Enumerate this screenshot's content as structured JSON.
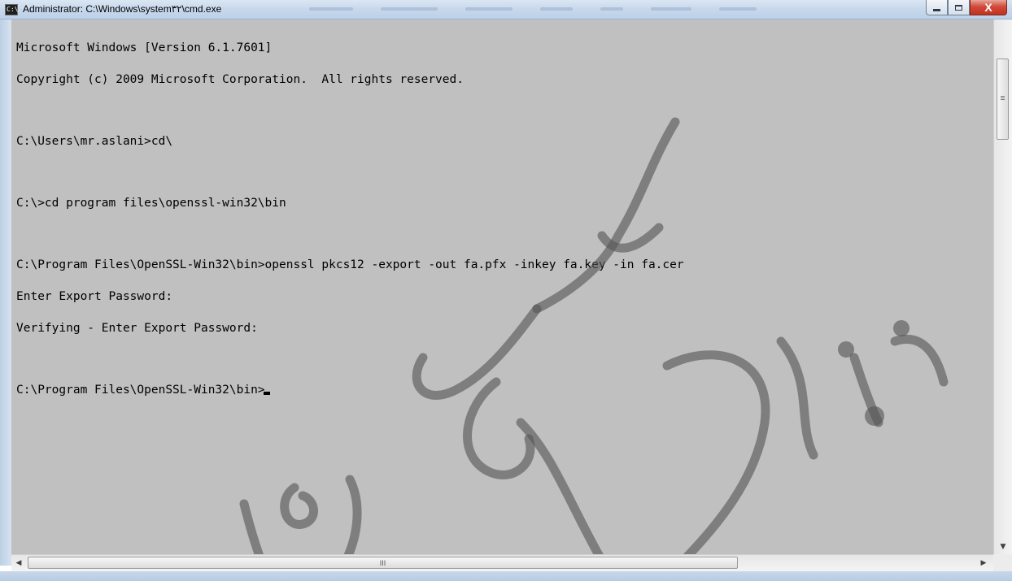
{
  "window": {
    "title": "Administrator: C:\\Windows\\system۳۲\\cmd.exe",
    "icon": "cmd-icon",
    "icon_text": "C:\\",
    "buttons": {
      "minimize": "minimize-icon",
      "maximize": "maximize-icon",
      "close_label": "X"
    }
  },
  "console": {
    "background": "#c0c0c0",
    "foreground": "#000000",
    "lines": [
      "Microsoft Windows [Version 6.1.7601]",
      "Copyright (c) 2009 Microsoft Corporation.  All rights reserved.",
      "",
      "C:\\Users\\mr.aslani>cd\\",
      "",
      "C:\\>cd program files\\openssl-win32\\bin",
      "",
      "C:\\Program Files\\OpenSSL-Win32\\bin>openssl pkcs12 -export -out fa.pfx -inkey fa.key -in fa.cer",
      "Enter Export Password:",
      "Verifying - Enter Export Password:",
      "",
      "C:\\Program Files\\OpenSSL-Win32\\bin>"
    ]
  },
  "watermark": {
    "text": "mr.aslani.ir"
  },
  "scrollbars": {
    "vertical": {
      "up_icon": "scroll-up-icon",
      "down_icon": "scroll-down-icon"
    },
    "horizontal": {
      "left_icon": "scroll-left-icon",
      "right_icon": "scroll-right-icon",
      "grip_text": "III"
    }
  }
}
